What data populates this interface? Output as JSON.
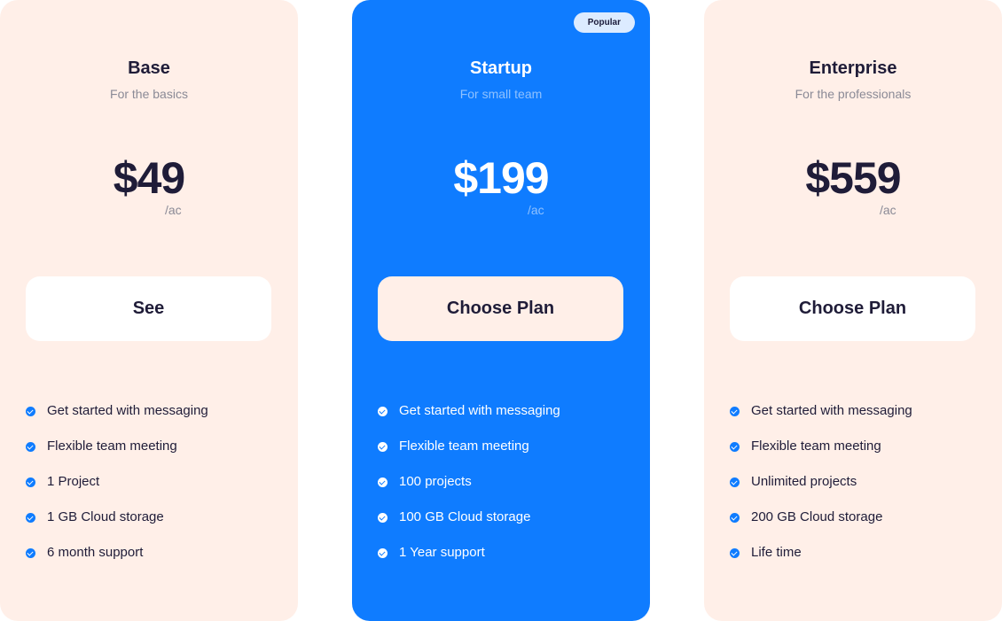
{
  "colors": {
    "accent": "#0F7CFF",
    "card_light": "#FFEFE8",
    "text_dark": "#1F1C38",
    "text_muted": "#8A8A96"
  },
  "plans": [
    {
      "name": "Base",
      "tagline": "For the basics",
      "price": "$49",
      "unit": "/ac",
      "button": "See",
      "features": [
        "Get started with messaging",
        "Flexible team meeting",
        "1 Project",
        "1 GB Cloud storage",
        "6 month support"
      ]
    },
    {
      "name": "Startup",
      "tagline": "For small team",
      "badge": "Popular",
      "price": "$199",
      "unit": "/ac",
      "button": "Choose Plan",
      "features": [
        "Get started with messaging",
        "Flexible team meeting",
        "100 projects",
        "100 GB Cloud storage",
        "1 Year support"
      ]
    },
    {
      "name": "Enterprise",
      "tagline": "For the professionals",
      "price": "$559",
      "unit": "/ac",
      "button": "Choose Plan",
      "features": [
        "Get started with messaging",
        "Flexible team meeting",
        "Unlimited projects",
        "200 GB Cloud storage",
        "Life time"
      ]
    }
  ],
  "icons": {
    "feature_bullet": "check-circle-icon"
  }
}
